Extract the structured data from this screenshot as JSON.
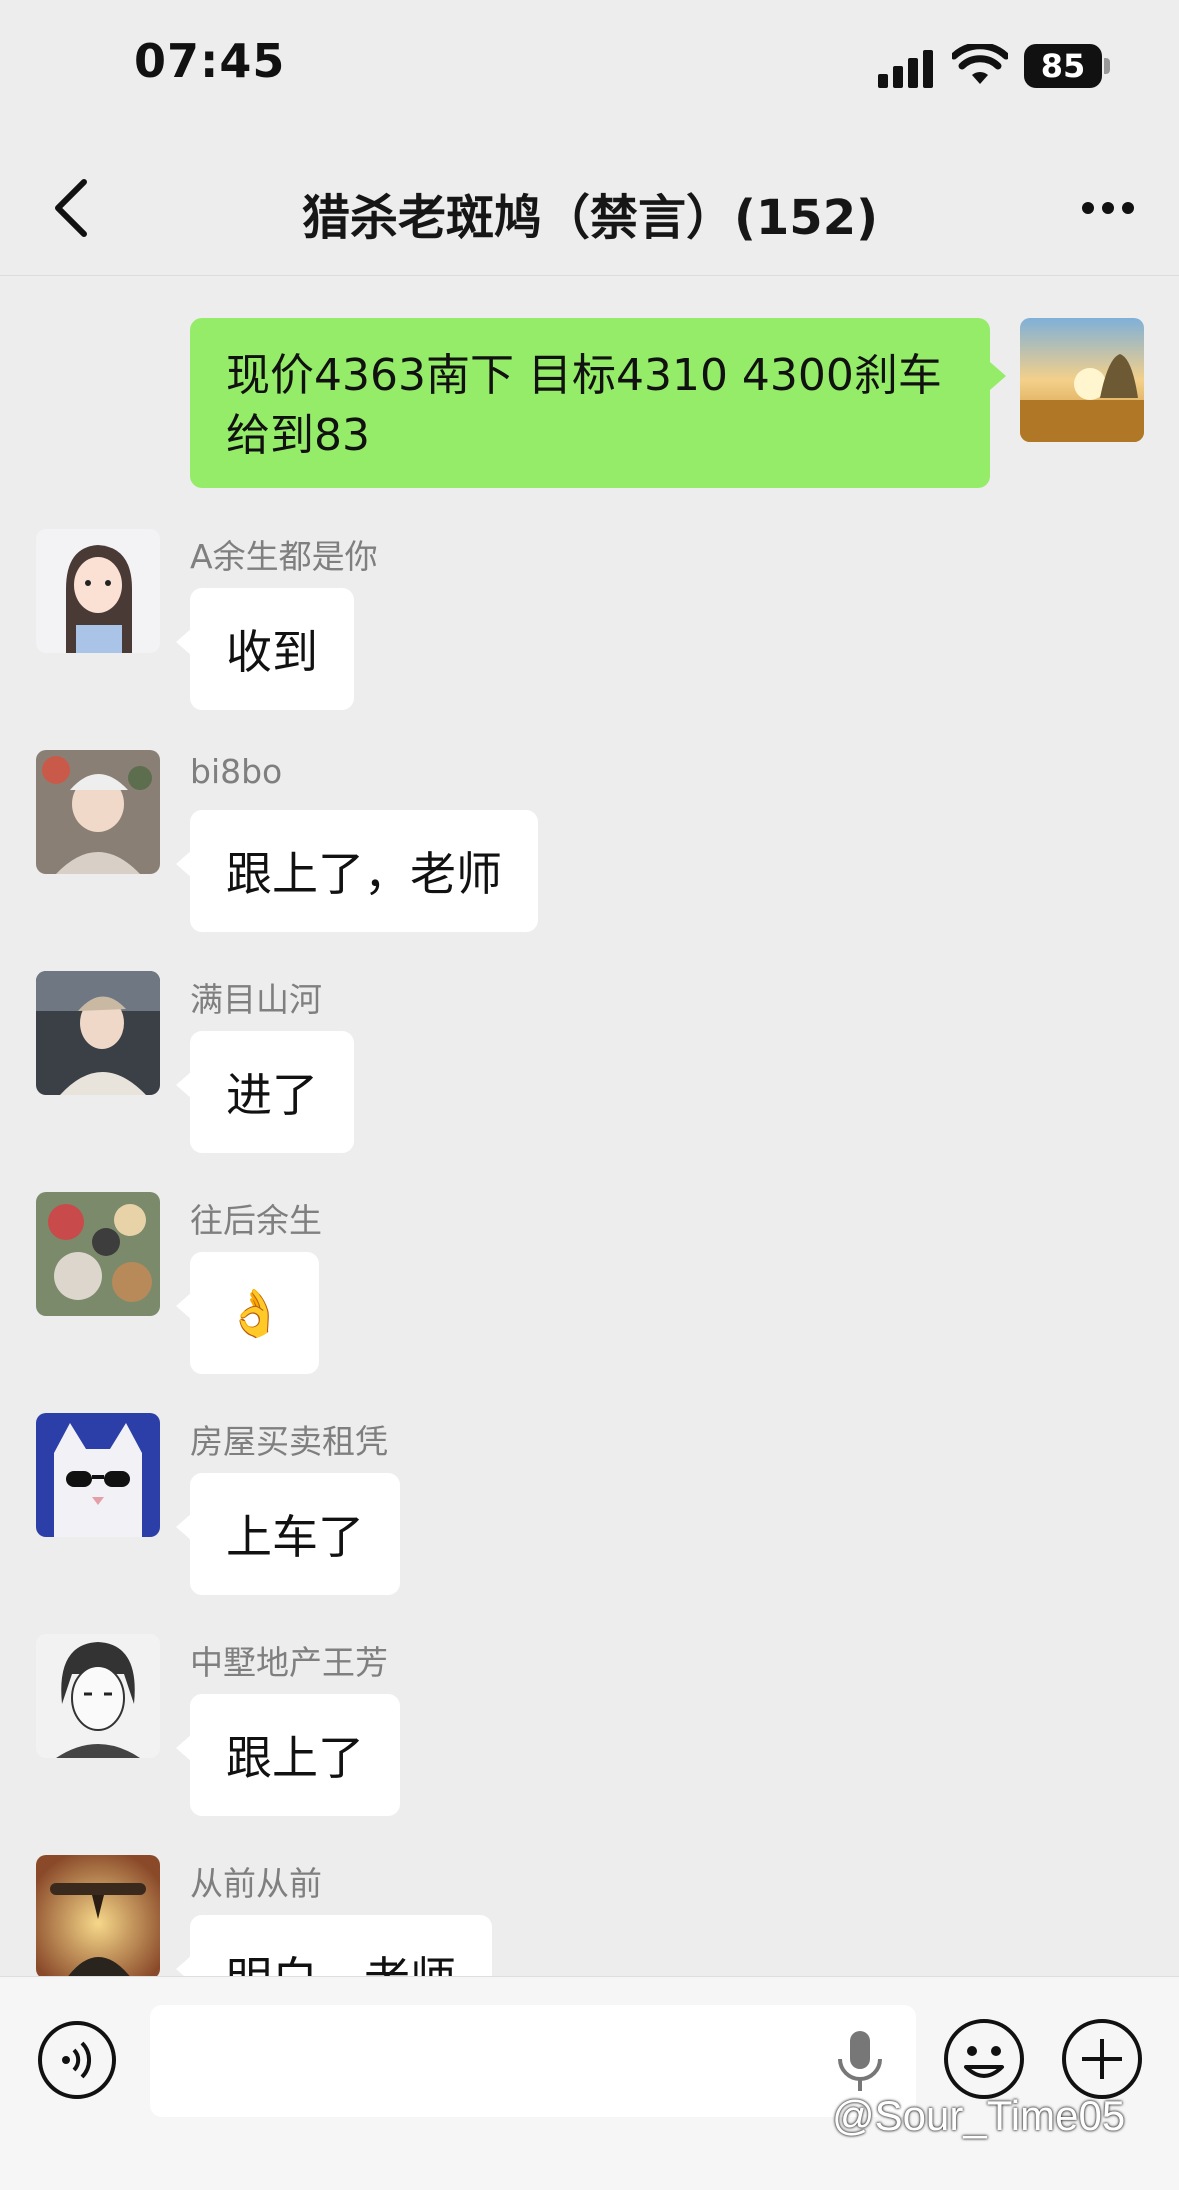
{
  "status_bar": {
    "time": "07:45",
    "battery": "85"
  },
  "header": {
    "title": "猎杀老斑鸠（禁言）(152)"
  },
  "self_message": {
    "text_line1": "现价4363南下 目标4310 4300刹车",
    "text_line2": "给到83"
  },
  "messages": [
    {
      "sender": "A余生都是你",
      "text": "收到"
    },
    {
      "sender": "bi8bo",
      "text": "跟上了，老师"
    },
    {
      "sender": "满目山河",
      "text": "进了"
    },
    {
      "sender": "往后余生",
      "text": "👌"
    },
    {
      "sender": "房屋买卖租凭",
      "text": "上车了"
    },
    {
      "sender": "中墅地产王芳",
      "text": "跟上了"
    },
    {
      "sender": "从前从前",
      "text": "明白，老师"
    }
  ],
  "watermark": "@Sour_Time05",
  "colors": {
    "self_bubble": "#95ec69",
    "background": "#ededed",
    "other_bubble": "#ffffff"
  }
}
